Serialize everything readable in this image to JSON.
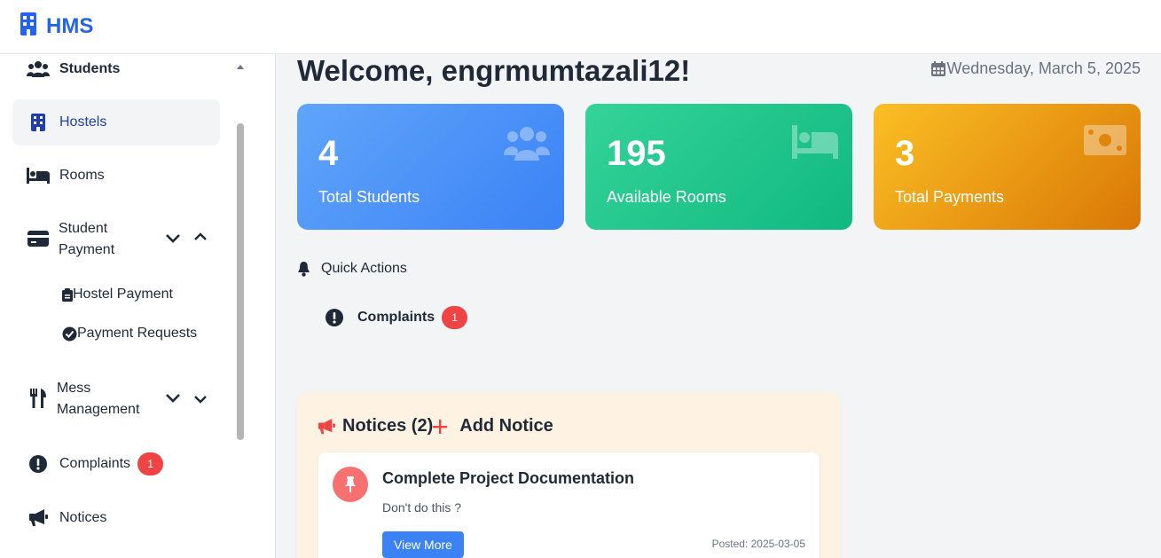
{
  "brand": {
    "name": "HMS",
    "icon": "building-icon",
    "color": "#2563eb"
  },
  "sidebar": {
    "items": [
      {
        "label": "Students",
        "icon": "users-icon"
      },
      {
        "label": "Hostels",
        "icon": "building-icon",
        "active": true
      },
      {
        "label": "Rooms",
        "icon": "bed-icon"
      },
      {
        "label_line1": "Student",
        "label_line2": "Payment",
        "icon": "credit-card-icon",
        "expanded": true
      },
      {
        "label_line1": "Mess",
        "label_line2": "Management",
        "icon": "utensils-icon"
      },
      {
        "label": "Complaints",
        "icon": "exclamation-circle-icon",
        "badge": "1"
      },
      {
        "label": "Notices",
        "icon": "bullhorn-icon"
      }
    ],
    "payment_sub": [
      {
        "label": "Hostel Payment",
        "icon": "clipboard-icon"
      },
      {
        "label": "Payment Requests",
        "icon": "check-circle-icon"
      }
    ]
  },
  "header": {
    "welcome": "Welcome, engrmumtazali12!",
    "date": "Wednesday, March 5, 2025"
  },
  "stats": [
    {
      "value": "4",
      "label": "Total Students",
      "icon": "users-icon",
      "color": "#3b82f6"
    },
    {
      "value": "195",
      "label": "Available Rooms",
      "icon": "bed-icon",
      "color": "#10b981"
    },
    {
      "value": "3",
      "label": "Total Payments",
      "icon": "money-bill-icon",
      "color": "#d97706"
    }
  ],
  "quick_actions": {
    "title": "Quick Actions",
    "items": [
      {
        "label": "Complaints",
        "badge": "1"
      }
    ]
  },
  "notices": {
    "title": "Notices (2)",
    "add_label": "Add Notice",
    "items": [
      {
        "title": "Complete Project Documentation",
        "body": "Don't do this ?",
        "button": "View More",
        "posted": "Posted: 2025-03-05"
      }
    ]
  }
}
